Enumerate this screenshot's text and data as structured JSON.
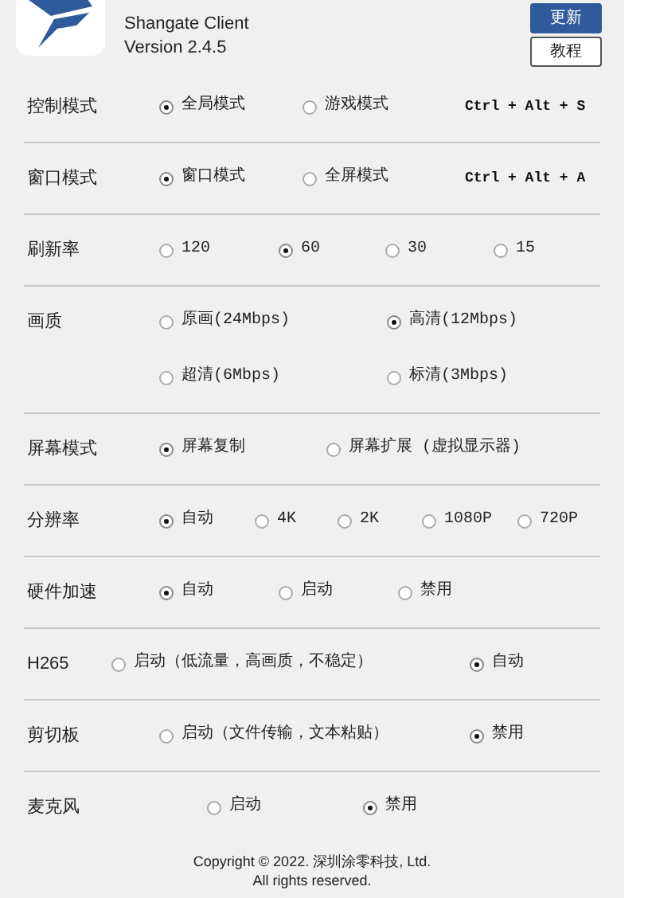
{
  "header": {
    "title": "Shangate Client",
    "version": "Version 2.4.5",
    "buttons": [
      {
        "label": "更新",
        "kind": "primary"
      },
      {
        "label": "教程",
        "kind": "secondary"
      }
    ]
  },
  "settings": [
    {
      "label": "控制模式",
      "option_rows": [
        [
          {
            "label": "全局模式",
            "selected": true
          },
          {
            "label": "游戏模式",
            "selected": false
          }
        ]
      ],
      "shortcut": "Ctrl + Alt + S"
    },
    {
      "label": "窗口模式",
      "option_rows": [
        [
          {
            "label": "窗口模式",
            "selected": true
          },
          {
            "label": "全屏模式",
            "selected": false
          }
        ]
      ],
      "shortcut": "Ctrl + Alt + A"
    },
    {
      "label": "刷新率",
      "option_rows": [
        [
          {
            "label": "120",
            "selected": false
          },
          {
            "label": "60",
            "selected": true
          },
          {
            "label": "30",
            "selected": false
          },
          {
            "label": "15",
            "selected": false
          }
        ]
      ]
    },
    {
      "label": "画质",
      "option_rows": [
        [
          {
            "label": "原画(24Mbps)",
            "selected": false
          },
          {
            "label": "高清(12Mbps)",
            "selected": true
          }
        ],
        [
          {
            "label": "超清(6Mbps)",
            "selected": false
          },
          {
            "label": "标清(3Mbps)",
            "selected": false
          }
        ]
      ]
    },
    {
      "label": "屏幕模式",
      "option_rows": [
        [
          {
            "label": "屏幕复制",
            "selected": true
          },
          {
            "label": "屏幕扩展 (虚拟显示器)",
            "selected": false
          }
        ]
      ]
    },
    {
      "label": "分辨率",
      "option_rows": [
        [
          {
            "label": "自动",
            "selected": true
          },
          {
            "label": "4K",
            "selected": false
          },
          {
            "label": "2K",
            "selected": false
          },
          {
            "label": "1080P",
            "selected": false
          },
          {
            "label": "720P",
            "selected": false
          }
        ]
      ]
    },
    {
      "label": "硬件加速",
      "option_rows": [
        [
          {
            "label": "自动",
            "selected": true
          },
          {
            "label": "启动",
            "selected": false
          },
          {
            "label": "禁用",
            "selected": false
          }
        ]
      ]
    },
    {
      "label": "H265",
      "option_rows": [
        [
          {
            "label": "启动（低流量，高画质，不稳定）",
            "selected": false
          },
          {
            "label": "自动",
            "selected": true
          }
        ]
      ]
    },
    {
      "label": "剪切板",
      "option_rows": [
        [
          {
            "label": "启动（文件传输，文本粘贴）",
            "selected": false
          },
          {
            "label": "禁用",
            "selected": true
          }
        ]
      ]
    },
    {
      "label": "麦克风",
      "option_rows": [
        [
          {
            "label": "启动",
            "selected": false
          },
          {
            "label": "禁用",
            "selected": true
          }
        ]
      ]
    }
  ],
  "footer": [
    "Copyright © 2022. 深圳涂零科技, Ltd.",
    "All rights reserved."
  ]
}
